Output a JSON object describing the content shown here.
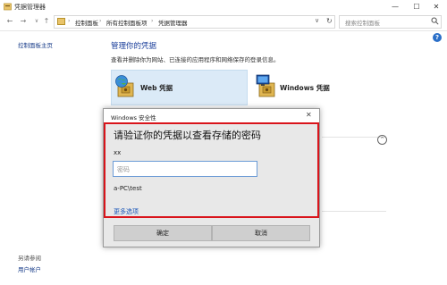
{
  "window": {
    "title": "凭据管理器",
    "min": "—",
    "max": "☐",
    "close": "✕"
  },
  "nav": {
    "back": "←",
    "forward": "→",
    "history": "∨",
    "up": "↑"
  },
  "breadcrumbs": [
    "控制面板",
    "所有控制面板项",
    "凭据管理器"
  ],
  "crumb_sep": "›",
  "path_dropdown": "∨",
  "refresh": "↻",
  "search": {
    "placeholder": "搜索控制面板"
  },
  "sidebar": {
    "home": "控制面板主页",
    "see_also": "另请参阅",
    "users": "用户帐户"
  },
  "main": {
    "help": "?",
    "heading": "管理你的凭据",
    "description": "查看并删除你为网站、已连接的应用程序和网络保存的登录信息。",
    "web_tile": "Web 凭据",
    "windows_tile": "Windows 凭据",
    "expand": "⌃"
  },
  "dialog": {
    "title": "Windows 安全性",
    "close": "✕",
    "heading": "请验证你的凭据以查看存储的密码",
    "user": "xx",
    "password_placeholder": "密码",
    "account": "a-PC\\test",
    "more_options": "更多选项",
    "ok": "确定",
    "cancel": "取消"
  },
  "colors": {
    "accent": "#1b3f9b",
    "highlight_box": "#d9141b",
    "tile_selected": "#dbeaf7"
  }
}
